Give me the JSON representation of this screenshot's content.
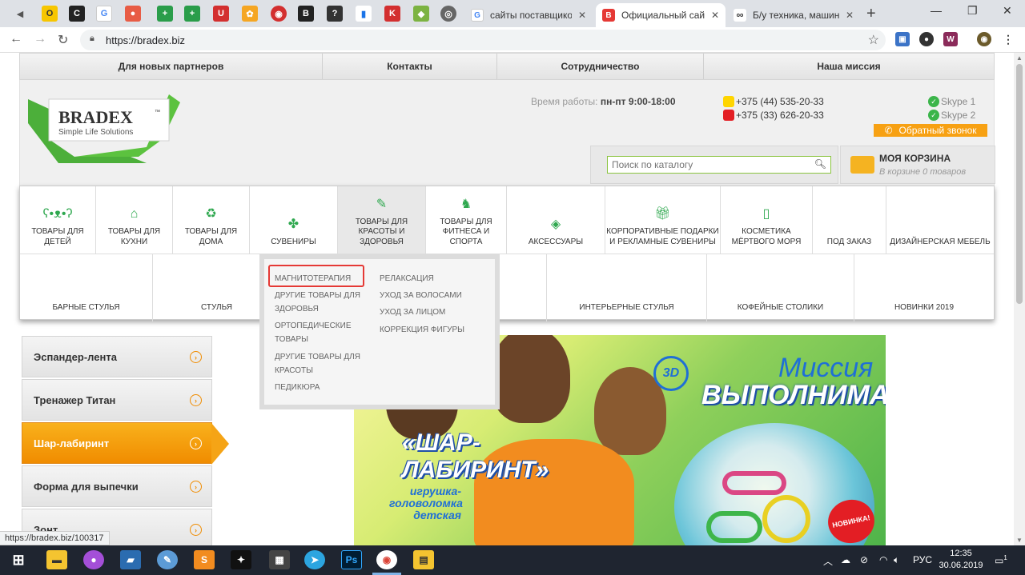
{
  "browser": {
    "tabs": [
      {
        "title": "сайты поставщиков",
        "icon": "google-icon",
        "active": false
      },
      {
        "title": "Официальный сайт",
        "icon": "bradex-favicon-icon",
        "active": true
      },
      {
        "title": "Б/у техника, машин",
        "icon": "ooft-favicon-icon",
        "active": false
      }
    ],
    "url": "https://bradex.biz",
    "status_url": "https://bradex.biz/100317"
  },
  "site": {
    "top_menu": [
      "Для новых партнеров",
      "Контакты",
      "Сотрудничество",
      "Наша миссия"
    ],
    "logo": {
      "name": "BRADEX",
      "tm": "™",
      "tagline": "Simple Life Solutions"
    },
    "hours_label": "Время работы:",
    "hours_value": "пн-пт 9:00-18:00",
    "phones": [
      "+375 (44) 535-20-33",
      "+375 (33) 626-20-33"
    ],
    "skype": [
      "Skype 1",
      "Skype 2"
    ],
    "callback_label": "Обратный звонок",
    "search_placeholder": "Поиск по каталогу",
    "cart": {
      "title": "МОЯ КОРЗИНА",
      "subtitle": "В корзине 0 товаров"
    },
    "categories": [
      {
        "label": "ТОВАРЫ ДЛЯ ДЕТЕЙ",
        "icon": "teddy-bear-icon"
      },
      {
        "label": "ТОВАРЫ ДЛЯ КУХНИ",
        "icon": "kitchen-icon"
      },
      {
        "label": "ТОВАРЫ ДЛЯ ДОМА",
        "icon": "cleaning-bucket-icon"
      },
      {
        "label": "СУВЕНИРЫ",
        "icon": "spinner-icon"
      },
      {
        "label": "ТОВАРЫ ДЛЯ КРАСОТЫ И ЗДОРОВЬЯ",
        "icon": "brush-icon"
      },
      {
        "label": "ТОВАРЫ ДЛЯ ФИТНЕСА И СПОРТА",
        "icon": "exercise-bike-icon"
      },
      {
        "label": "АКСЕССУАРЫ",
        "icon": "gem-icon"
      },
      {
        "label": "КОРПОРАТИВНЫЕ ПОДАРКИ И РЕКЛАМНЫЕ СУВЕНИРЫ",
        "icon": "gift-icon"
      },
      {
        "label": "КОСМЕТИКА МЁРТВОГО МОРЯ",
        "icon": "cosmetics-tube-icon"
      },
      {
        "label": "ПОД ЗАКАЗ",
        "icon": ""
      },
      {
        "label": "ДИЗАЙНЕРСКАЯ МЕБЕЛЬ",
        "icon": ""
      }
    ],
    "categories_row2": [
      "БАРНЫЕ СТУЛЬЯ",
      "СТУЛЬЯ",
      "",
      "",
      "ИНТЕРЬЕРНЫЕ СТУЛЬЯ",
      "КОФЕЙНЫЕ СТОЛИКИ",
      "НОВИНКИ 2019"
    ],
    "dropdown": {
      "col1": [
        "МАГНИТОТЕРАПИЯ",
        "ДРУГИЕ ТОВАРЫ ДЛЯ ЗДОРОВЬЯ",
        "ОРТОПЕДИЧЕСКИЕ ТОВАРЫ",
        "ДРУГИЕ ТОВАРЫ ДЛЯ КРАСОТЫ",
        "ПЕДИКЮРА"
      ],
      "col2": [
        "РЕЛАКСАЦИЯ",
        "УХОД ЗА ВОЛОСАМИ",
        "УХОД ЗА ЛИЦОМ",
        "КОРРЕКЦИЯ ФИГУРЫ"
      ],
      "highlighted": "МАГНИТОТЕРАПИЯ"
    },
    "sidebar": [
      {
        "label": "Эспандер-лента",
        "active": false
      },
      {
        "label": "Тренажер Титан",
        "active": false
      },
      {
        "label": "Шар-лабиринт",
        "active": true
      },
      {
        "label": "Форма для выпечки",
        "active": false
      },
      {
        "label": "Зонт",
        "active": false
      }
    ],
    "banner": {
      "badge_3d": "3D",
      "mission_1": "Миссия",
      "mission_2": "ВЫПОЛНИМА!",
      "title_1": "«ШАР-",
      "title_2": "ЛАБИРИНТ»",
      "subtitle": "игрушка-головоломка детская",
      "new_badge": "НОВИНКА!"
    }
  },
  "taskbar": {
    "language": "РУС",
    "time": "12:35",
    "date": "30.06.2019",
    "notifications": "1"
  },
  "colors": {
    "accent_orange": "#f7a113",
    "brand_green": "#2fa84f",
    "highlight_red": "#e53935"
  }
}
